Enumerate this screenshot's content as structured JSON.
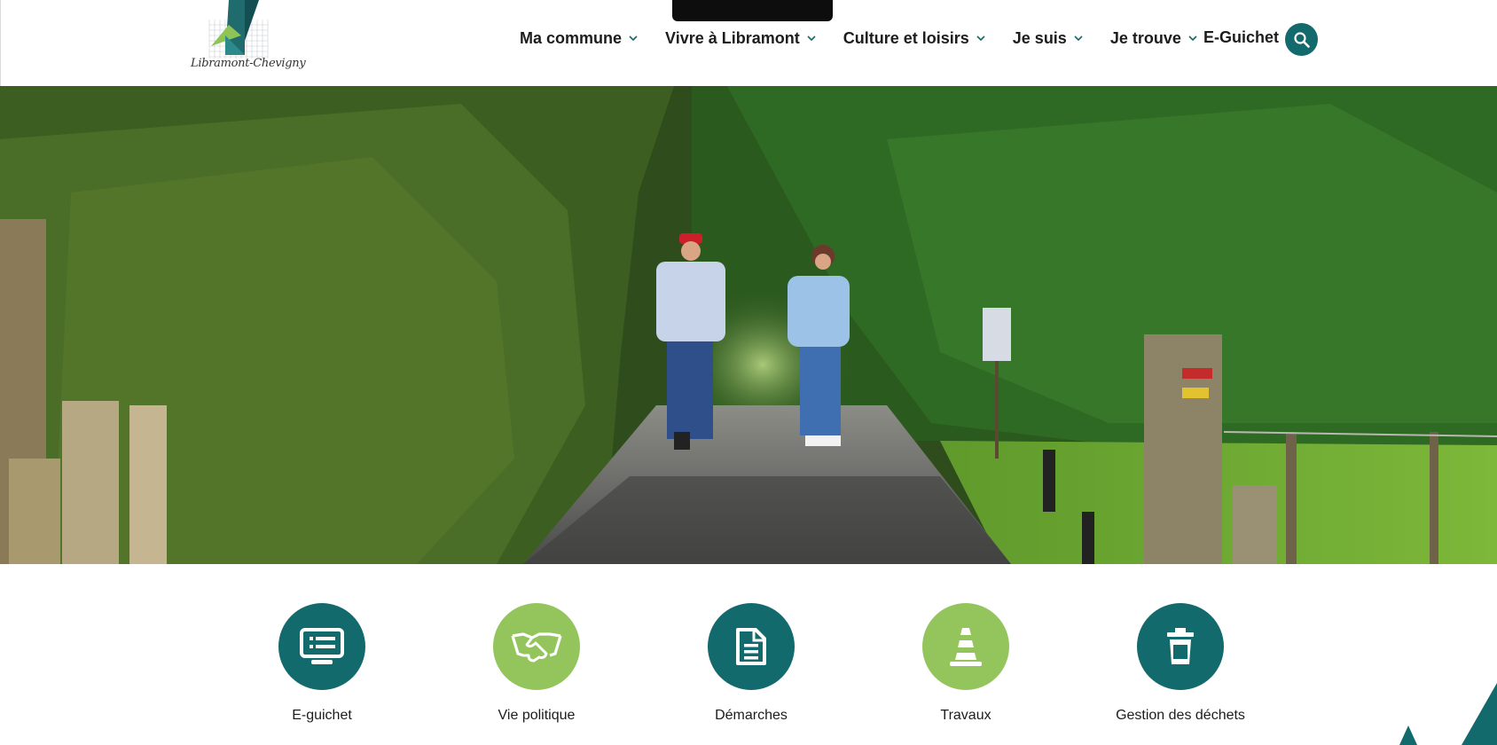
{
  "header": {
    "logo_text": "Libramont-Chevigny",
    "nav": [
      {
        "label": "Ma commune"
      },
      {
        "label": "Vivre à Libramont"
      },
      {
        "label": "Culture et loisirs"
      },
      {
        "label": "Je suis"
      },
      {
        "label": "Je trouve"
      }
    ],
    "eguichet_label": "E-Guichet",
    "search_icon": "search-icon"
  },
  "hero": {
    "image": "photo of a couple walking on a gravel path between green hedges and trees"
  },
  "quick_links": [
    {
      "label": "E-guichet",
      "icon": "screen-list-icon",
      "color": "#136a6c"
    },
    {
      "label": "Vie politique",
      "icon": "handshake-icon",
      "color": "#93c55c"
    },
    {
      "label": "Démarches",
      "icon": "document-icon",
      "color": "#136a6c"
    },
    {
      "label": "Travaux",
      "icon": "traffic-cone-icon",
      "color": "#93c55c"
    },
    {
      "label": "Gestion des déchets",
      "icon": "trash-bin-icon",
      "color": "#136a6c"
    }
  ],
  "colors": {
    "teal": "#136a6c",
    "green": "#93c55c"
  }
}
